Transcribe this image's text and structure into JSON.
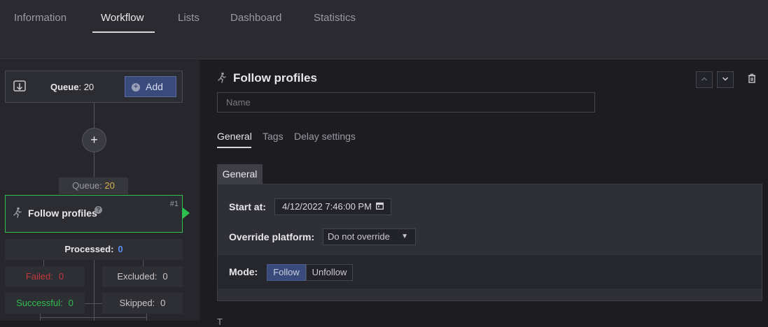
{
  "topnav": {
    "tabs": [
      {
        "label": "Information"
      },
      {
        "label": "Workflow"
      },
      {
        "label": "Lists"
      },
      {
        "label": "Dashboard"
      },
      {
        "label": "Statistics"
      }
    ],
    "active": "Workflow"
  },
  "workflow": {
    "queue_box": {
      "label": "Queue",
      "value": ": 20",
      "add_label": "Add",
      "icon": "download-icon"
    },
    "add_step_symbol": "+",
    "queue_tag": {
      "label": "Queue:",
      "value": "20"
    },
    "step": {
      "title": "Follow profiles",
      "number": "#1",
      "help": "?",
      "icon": "runner-icon"
    },
    "processed": {
      "label": "Processed:",
      "value": "0"
    },
    "failed": {
      "label": "Failed:",
      "value": "0"
    },
    "excluded": {
      "label": "Excluded:",
      "value": "0"
    },
    "successful": {
      "label": "Successful:",
      "value": "0"
    },
    "skipped": {
      "label": "Skipped:",
      "value": "0"
    },
    "colors": {
      "success": "#2fbf4f",
      "failed": "#c0393b",
      "queue_value": "#d7b24a",
      "processed_value": "#5b8ef0"
    }
  },
  "detail": {
    "title": "Follow profiles",
    "name_placeholder": "Name",
    "subtabs": [
      {
        "label": "General"
      },
      {
        "label": "Tags"
      },
      {
        "label": "Delay settings"
      }
    ],
    "section_tab": "General",
    "start_at": {
      "label": "Start at:",
      "value": "4/12/2022 7:46:00 PM"
    },
    "override_platform": {
      "label": "Override platform:",
      "value": "Do not override"
    },
    "mode": {
      "label": "Mode:",
      "options": [
        "Follow",
        "Unfollow"
      ],
      "selected": "Follow"
    },
    "tail_text": "T"
  }
}
